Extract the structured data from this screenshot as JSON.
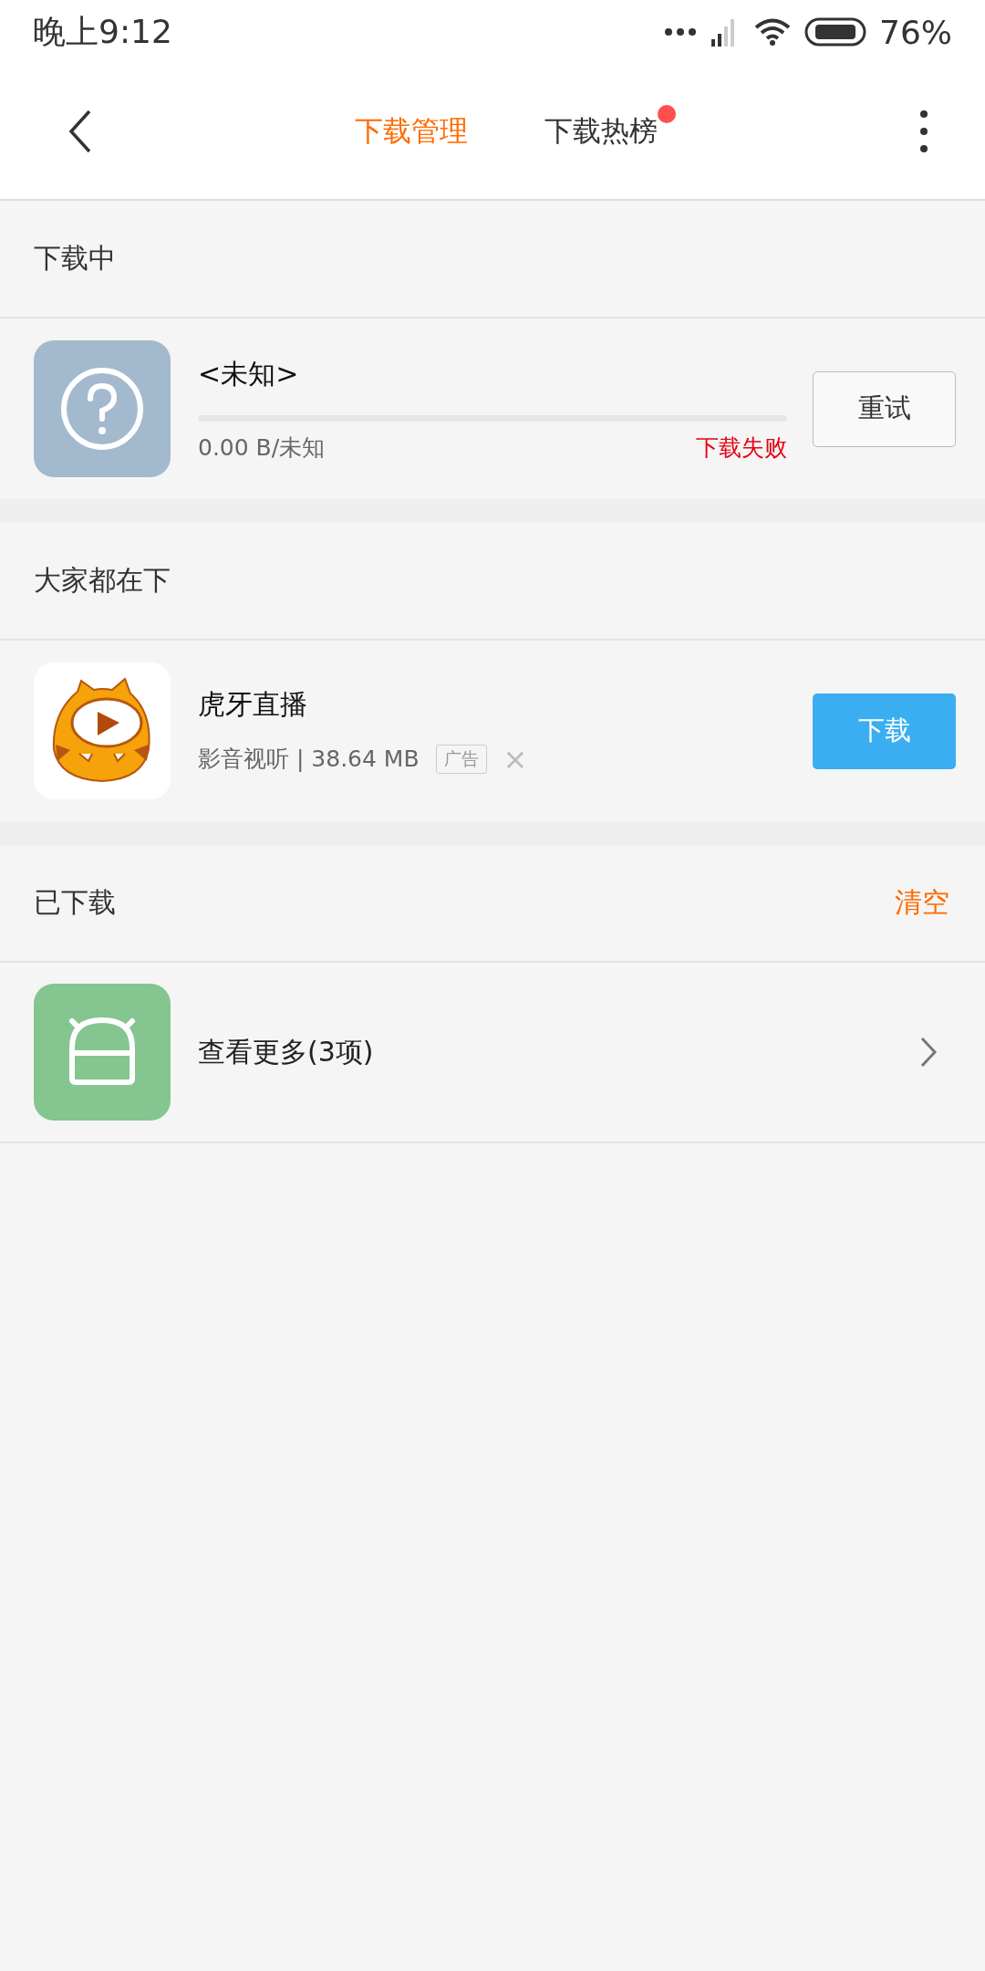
{
  "status_bar": {
    "time": "晚上9:12",
    "battery": "76%"
  },
  "tabs": [
    {
      "label": "下载管理",
      "selected": true,
      "dot": false
    },
    {
      "label": "下载热榜",
      "selected": false,
      "dot": true
    }
  ],
  "downloading": {
    "title": "下载中",
    "items": [
      {
        "name": "<未知>",
        "level": 0,
        "size": "0.00 B/未知",
        "status": "下载失败",
        "button": "重试"
      }
    ]
  },
  "popular": {
    "title": "大家都在下",
    "items": [
      {
        "name": "虎牙直播",
        "info": "影音视听 | 38.64 MB",
        "tag": "广告",
        "close": "×",
        "button": "下载"
      }
    ]
  },
  "downloaded": {
    "title": "已下载",
    "action": "清空",
    "more": "查看更多(3项)"
  }
}
